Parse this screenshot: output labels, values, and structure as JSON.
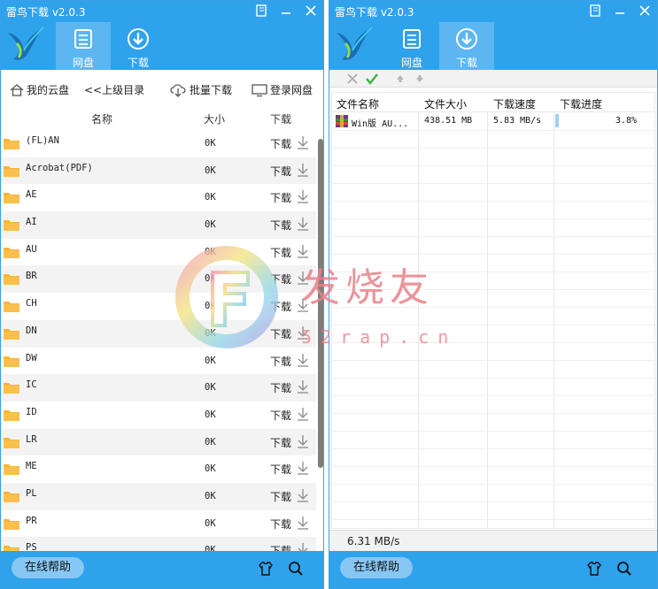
{
  "left_window": {
    "title": "雷鸟下载 v2.0.3",
    "tabs": [
      {
        "label": "网盘",
        "icon": "cloud-disk-icon",
        "active": true
      },
      {
        "label": "下载",
        "icon": "download-circle-icon",
        "active": false
      }
    ],
    "toolbar": {
      "my_cloud": "我的云盘",
      "up_level": "<<上级目录",
      "batch_download": "批量下载",
      "login_disk": "登录网盘"
    },
    "columns": {
      "name": "名称",
      "size": "大小",
      "download": "下载"
    },
    "files": [
      {
        "name": "(FL)AN",
        "size": "0K",
        "action": "下载"
      },
      {
        "name": "Acrobat(PDF)",
        "size": "0K",
        "action": "下载"
      },
      {
        "name": "AE",
        "size": "0K",
        "action": "下载"
      },
      {
        "name": "AI",
        "size": "0K",
        "action": "下载"
      },
      {
        "name": "AU",
        "size": "0K",
        "action": "下载"
      },
      {
        "name": "BR",
        "size": "0K",
        "action": "下载"
      },
      {
        "name": "CH",
        "size": "0K",
        "action": "下载"
      },
      {
        "name": "DN",
        "size": "0K",
        "action": "下载"
      },
      {
        "name": "DW",
        "size": "0K",
        "action": "下载"
      },
      {
        "name": "IC",
        "size": "0K",
        "action": "下载"
      },
      {
        "name": "ID",
        "size": "0K",
        "action": "下载"
      },
      {
        "name": "LR",
        "size": "0K",
        "action": "下载"
      },
      {
        "name": "ME",
        "size": "0K",
        "action": "下载"
      },
      {
        "name": "PL",
        "size": "0K",
        "action": "下载"
      },
      {
        "name": "PR",
        "size": "0K",
        "action": "下载"
      },
      {
        "name": "PS",
        "size": "0K",
        "action": "下载"
      }
    ],
    "help_button": "在线帮助"
  },
  "right_window": {
    "title": "雷鸟下载 v2.0.3",
    "tabs": [
      {
        "label": "网盘",
        "icon": "cloud-disk-icon",
        "active": false
      },
      {
        "label": "下载",
        "icon": "download-circle-icon",
        "active": true
      }
    ],
    "columns": {
      "name": "文件名称",
      "size": "文件大小",
      "speed": "下载速度",
      "progress": "下载进度"
    },
    "tasks": [
      {
        "name": "Win版 AU...",
        "size": "438.51 MB",
        "speed": "5.83 MB/s",
        "progress_text": "3.8%",
        "progress": 0.038
      }
    ],
    "status_speed": "6.31 MB/s",
    "help_button": "在线帮助"
  },
  "watermark": {
    "text": "发烧友",
    "url": "52rap.cn"
  },
  "colors": {
    "accent": "#2fa2ec",
    "accent_active": "#5bb6f1",
    "folder": "#f5b53a",
    "watermark_red": "#e8828a"
  }
}
